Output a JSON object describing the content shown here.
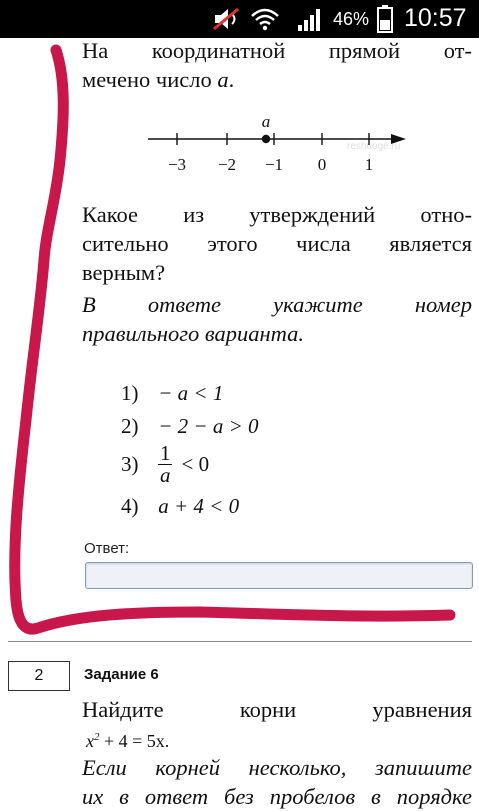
{
  "status_bar": {
    "battery_percent": "46%",
    "time": "10:57",
    "icons": [
      "mute-icon",
      "wifi-icon",
      "signal-icon",
      "battery-icon"
    ]
  },
  "task1": {
    "intro_line1": "На координатной прямой от-",
    "intro_line2_prefix": "мечено число ",
    "intro_var": "a",
    "intro_line2_suffix": ".",
    "number_line": {
      "point_label": "a",
      "ticks": [
        "−3",
        "−2",
        "−1",
        "0",
        "1"
      ],
      "watermark": "reshuoge.ru"
    },
    "question_line1": "Какое из утверждений отно-",
    "question_line2": "сительно этого числа является",
    "question_line3": "верным?",
    "instruction_line1": "В ответе укажите номер",
    "instruction_line2": "правильного варианта.",
    "options": [
      {
        "number": "1)",
        "expr": "− a < 1"
      },
      {
        "number": "2)",
        "expr": "− 2 − a > 0"
      },
      {
        "number": "3)",
        "numerator": "1",
        "denominator": "a",
        "rest": "< 0"
      },
      {
        "number": "4)",
        "expr": "a + 4 < 0"
      }
    ],
    "answer_label": "Ответ:",
    "answer_value": ""
  },
  "task2": {
    "number": "2",
    "title": "Задание 6",
    "line1": "Найдите корни уравнения",
    "equation": {
      "base": "x",
      "exp": "2",
      "rest": " + 4 = 5x."
    },
    "line2": "Если корней несколько, запишите",
    "line3": "их в ответ без пробелов в порядке"
  },
  "colors": {
    "annotation_stroke": "#c8174a",
    "input_border": "#7c9ac2",
    "input_bg": "#eef2f8"
  }
}
